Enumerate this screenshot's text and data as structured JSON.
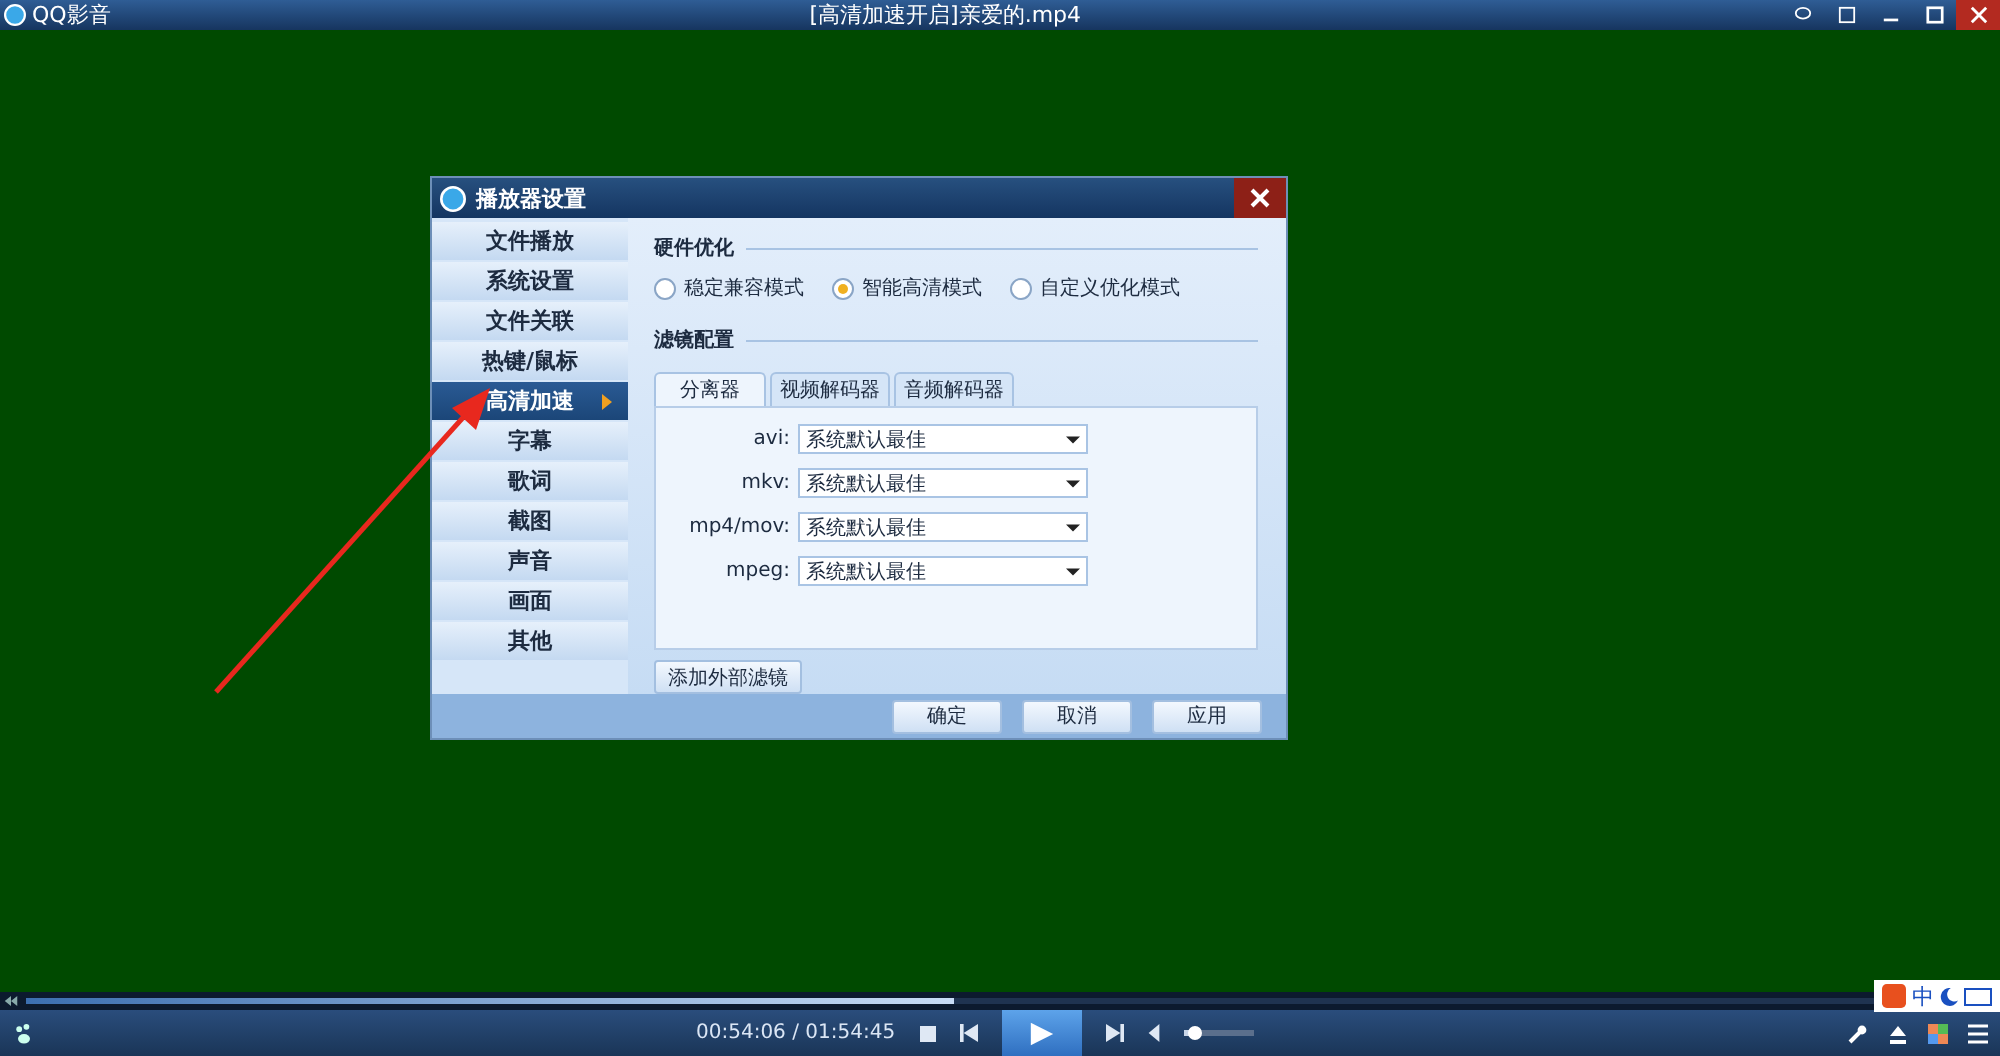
{
  "app": {
    "name": "QQ影音",
    "title": "[高清加速开启]亲爱的.mp4"
  },
  "dialog": {
    "title": "播放器设置",
    "sidebar": [
      {
        "label": "文件播放",
        "selected": false
      },
      {
        "label": "系统设置",
        "selected": false
      },
      {
        "label": "文件关联",
        "selected": false
      },
      {
        "label": "热键/鼠标",
        "selected": false
      },
      {
        "label": "高清加速",
        "selected": true
      },
      {
        "label": "字幕",
        "selected": false
      },
      {
        "label": "歌词",
        "selected": false
      },
      {
        "label": "截图",
        "selected": false
      },
      {
        "label": "声音",
        "selected": false
      },
      {
        "label": "画面",
        "selected": false
      },
      {
        "label": "其他",
        "selected": false
      }
    ],
    "hardware": {
      "heading": "硬件优化",
      "options": [
        {
          "label": "稳定兼容模式",
          "selected": false
        },
        {
          "label": "智能高清模式",
          "selected": true
        },
        {
          "label": "自定义优化模式",
          "selected": false
        }
      ]
    },
    "filters": {
      "heading": "滤镜配置",
      "tabs": [
        {
          "label": "分离器",
          "selected": true
        },
        {
          "label": "视频解码器",
          "selected": false
        },
        {
          "label": "音频解码器",
          "selected": false
        }
      ],
      "rows": [
        {
          "label": "avi:",
          "value": "系统默认最佳"
        },
        {
          "label": "mkv:",
          "value": "系统默认最佳"
        },
        {
          "label": "mp4/mov:",
          "value": "系统默认最佳"
        },
        {
          "label": "mpeg:",
          "value": "系统默认最佳"
        }
      ],
      "add_button": "添加外部滤镜"
    },
    "buttons": [
      "确定",
      "取消",
      "应用"
    ]
  },
  "player": {
    "progress": {
      "level": 0.47
    },
    "time": "00:54:06 / 01:54:45",
    "volume": {
      "level": 0.15
    },
    "ime": "中"
  }
}
